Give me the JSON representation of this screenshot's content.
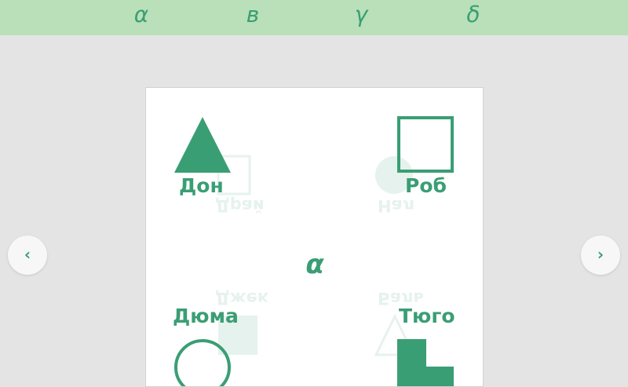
{
  "tabs": [
    "α",
    "в",
    "γ",
    "δ"
  ],
  "card": {
    "center_letter": "α",
    "items": [
      {
        "label": "Дон",
        "shape": "triangle-icon"
      },
      {
        "label": "Роб",
        "shape": "square-outline-icon"
      },
      {
        "label": "Дюма",
        "shape": "circle-outline-icon"
      },
      {
        "label": "Тюго",
        "shape": "l-block-icon"
      }
    ],
    "ghost_labels": [
      "Драй",
      "Нал",
      "Джек",
      "Баль"
    ]
  },
  "nav": {
    "prev": "‹",
    "next": "›"
  },
  "colors": {
    "accent": "#3a9e74",
    "topbar": "#b9e0b8",
    "background": "#e4e4e4"
  }
}
